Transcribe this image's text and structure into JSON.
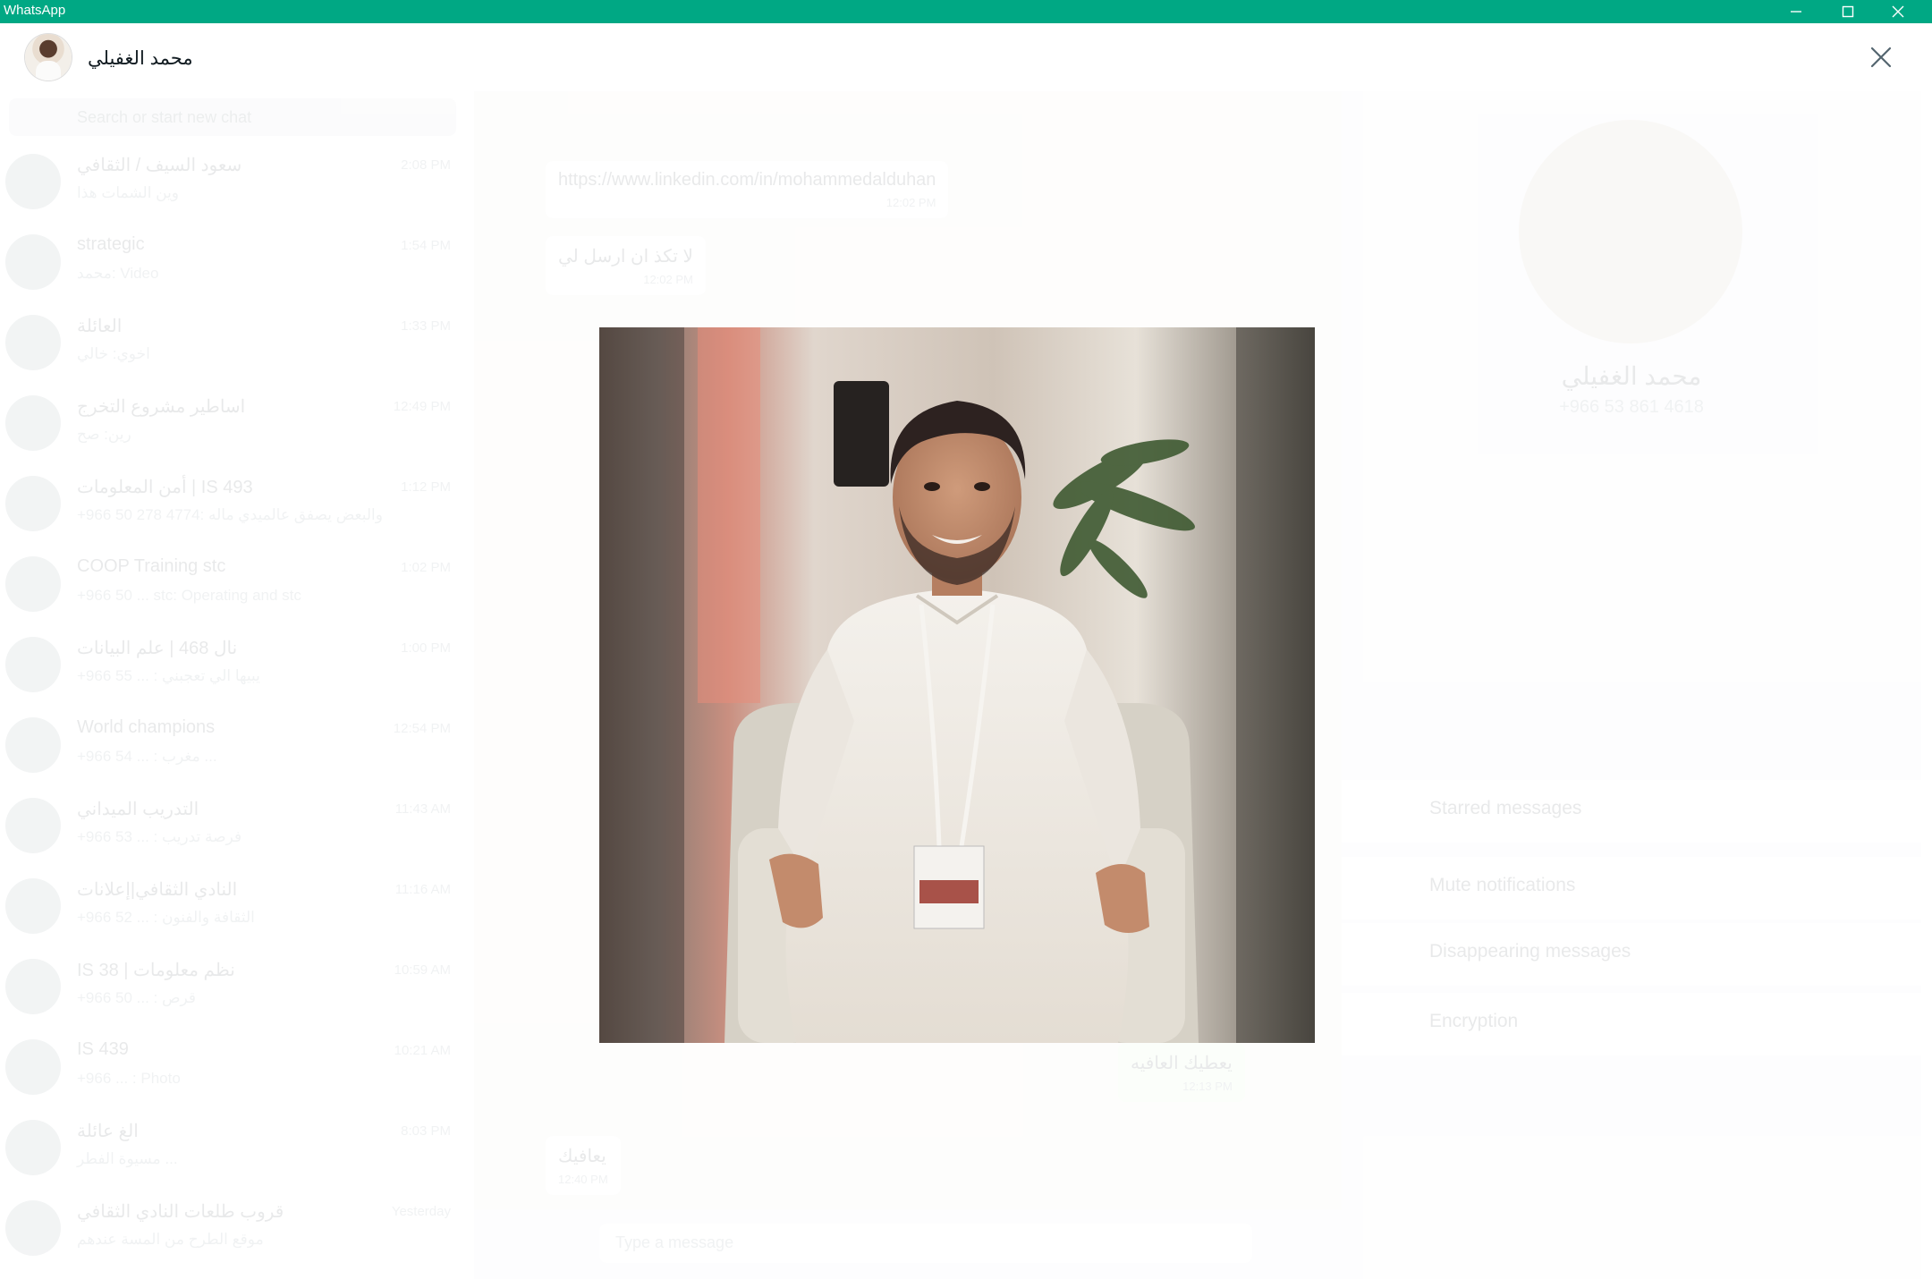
{
  "window": {
    "title": "WhatsApp",
    "controls": [
      "minimize-icon",
      "maximize-icon",
      "close-icon"
    ],
    "accent_color": "#00a884"
  },
  "viewer": {
    "sender_name": "محمد الغفيلي",
    "close_icon": "close-icon"
  },
  "background": {
    "search_placeholder": "Search or start new chat",
    "chats": [
      {
        "name": "سعود السيف / الثقافي",
        "time": "2:08 PM",
        "preview": "وين الشمات هذا"
      },
      {
        "name": "strategic",
        "time": "1:54 PM",
        "preview": "محمد: Video"
      },
      {
        "name": "العائلة",
        "time": "1:33 PM",
        "preview": "اخوي: خالي"
      },
      {
        "name": "اساطير مشروع التخرج",
        "time": "12:49 PM",
        "preview": "رين: صح"
      },
      {
        "name": "أمن المعلومات | IS 493",
        "time": "1:12 PM",
        "preview": "+966 50 278 4774: والبعض يصفق عالميدي ماله"
      },
      {
        "name": "COOP Training stc",
        "time": "1:02 PM",
        "preview": "+966 50 ... stc: Operating and stc"
      },
      {
        "name": "نال 468 | علم البيانات",
        "time": "1:00 PM",
        "preview": "+966 55 ... : يبيها الي تعجبني"
      },
      {
        "name": "World champions",
        "time": "12:54 PM",
        "preview": "+966 54 ... : مغرب ..."
      },
      {
        "name": "التدريب الميداني",
        "time": "11:43 AM",
        "preview": "+966 53 ... : فرصة تدريب"
      },
      {
        "name": "النادي الثقافي|إعلانات",
        "time": "11:16 AM",
        "preview": "+966 52 ... : الثقافة والفنون"
      },
      {
        "name": "IS 38 | نظم معلومات",
        "time": "10:59 AM",
        "preview": "+966 50 ... : قرص"
      },
      {
        "name": "IS 439",
        "time": "10:21 AM",
        "preview": "+966 ... : Photo"
      },
      {
        "name": "الغ عائلة",
        "time": "8:03 PM",
        "preview": "مسيوة الفطر ..."
      },
      {
        "name": "قروب طلعات النادي الثقافي",
        "time": "Yesterday",
        "preview": "موقع الطرح من المسة عندهم"
      }
    ],
    "messages": [
      {
        "text": "https://www.linkedin.com/in/mohammedalduhan",
        "time": "12:02 PM",
        "dir": "in"
      },
      {
        "text": "لا تكذ ان ارسل لي",
        "time": "12:02 PM",
        "dir": "in"
      },
      {
        "text": "يعطيك العافيه",
        "time": "12:13 PM",
        "dir": "out"
      },
      {
        "text": "يعافيك",
        "time": "12:40 PM",
        "dir": "in"
      }
    ],
    "input_placeholder": "Type a message",
    "contact": {
      "name": "محمد الغفيلي",
      "phone": "+966 53 861 4618",
      "rows": [
        "Starred messages",
        "Mute notifications",
        "Disappearing messages",
        "Encryption"
      ]
    }
  },
  "media": {
    "description_icon": "photo-portrait"
  }
}
